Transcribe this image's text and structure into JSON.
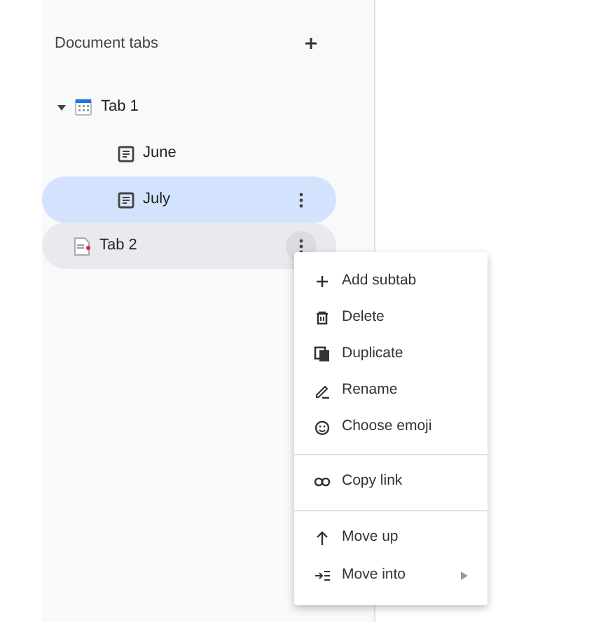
{
  "panel": {
    "title": "Document tabs"
  },
  "tabs": [
    {
      "label": "Tab 1",
      "selected": false,
      "expanded": true,
      "menu_open": false,
      "children": [
        {
          "label": "June",
          "selected": false,
          "menu_open": false
        },
        {
          "label": "July",
          "selected": true,
          "menu_open": false
        }
      ]
    },
    {
      "label": "Tab 2",
      "selected": false,
      "menu_open": true
    }
  ],
  "menu": [
    {
      "label": "Add subtab",
      "separator_before": false,
      "has_submenu": false
    },
    {
      "label": "Delete",
      "separator_before": false,
      "has_submenu": false
    },
    {
      "label": "Duplicate",
      "separator_before": false,
      "has_submenu": false
    },
    {
      "label": "Rename",
      "separator_before": false,
      "has_submenu": false
    },
    {
      "label": "Choose emoji",
      "separator_before": false,
      "has_submenu": false
    },
    {
      "label": "Copy link",
      "separator_before": true,
      "has_submenu": false
    },
    {
      "label": "Move up",
      "separator_before": true,
      "has_submenu": false
    },
    {
      "label": "Move into",
      "separator_before": false,
      "has_submenu": true
    }
  ]
}
